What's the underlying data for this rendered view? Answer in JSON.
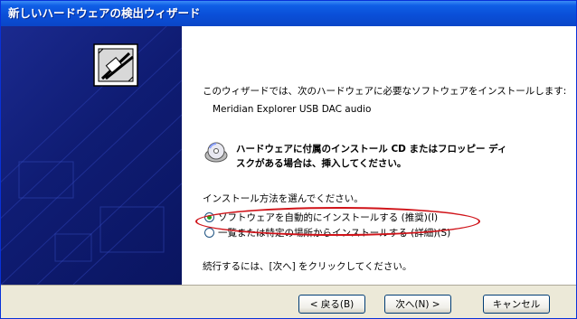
{
  "window": {
    "title": "新しいハードウェアの検出ウィザード"
  },
  "content": {
    "intro": "このウィザードでは、次のハードウェアに必要なソフトウェアをインストールします:",
    "device_name": "Meridian Explorer USB DAC audio",
    "cd_notice_line1": "ハードウェアに付属のインストール CD またはフロッピー ディ",
    "cd_notice_line2": "スクがある場合は、挿入してください。",
    "choose_method": "インストール方法を選んでください。",
    "option_auto": "ソフトウェアを自動的にインストールする (推奨)(I)",
    "option_manual": "一覧または特定の場所からインストールする (詳細)(S)",
    "continue_hint": "続行するには、[次へ] をクリックしてください。"
  },
  "buttons": {
    "back": "< 戻る(B)",
    "next": "次へ(N) >",
    "cancel": "キャンセル"
  },
  "icons": {
    "banner": "hardware-card-icon",
    "cd": "cd-disc-icon"
  },
  "colors": {
    "title_bar": "#0a4fd8",
    "highlight_ellipse": "#d0141a",
    "banner": "#0f1c73"
  }
}
